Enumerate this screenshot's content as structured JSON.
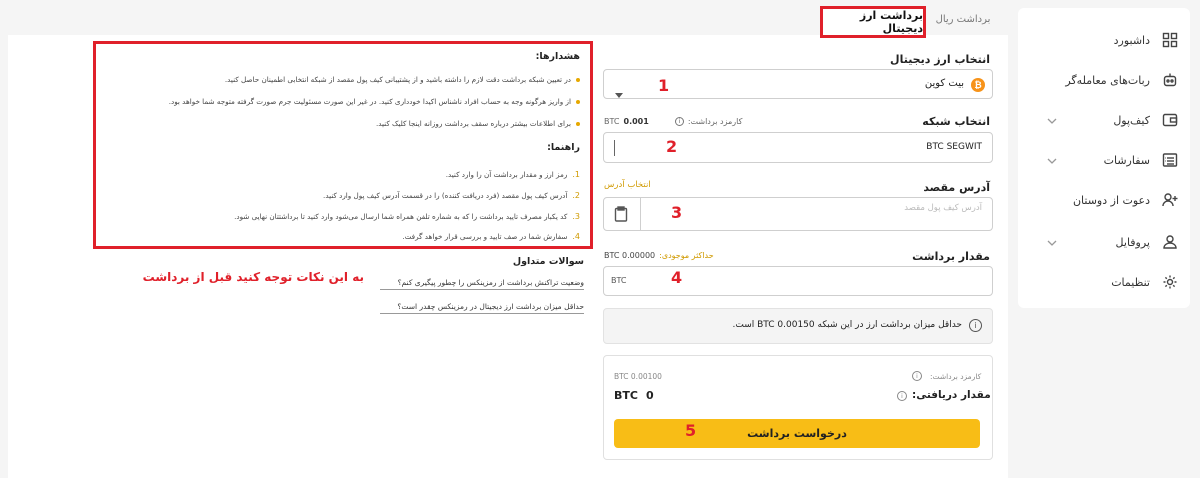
{
  "sidebar": {
    "items": [
      {
        "label": "داشبورد",
        "icon": "grid-icon"
      },
      {
        "label": "ربات‌های معامله‌گر",
        "icon": "robot-icon"
      },
      {
        "label": "کیف‌پول",
        "icon": "wallet-icon"
      },
      {
        "label": "سفارشات",
        "icon": "orders-icon"
      },
      {
        "label": "دعوت از دوستان",
        "icon": "add-user-icon"
      },
      {
        "label": "پروفایل",
        "icon": "user-icon"
      },
      {
        "label": "تنظیمات",
        "icon": "gear-icon"
      }
    ]
  },
  "tabs": {
    "crypto": "برداشت ارز دیجیتال",
    "rial": "برداشت ریال"
  },
  "form": {
    "currency_label": "انتخاب ارز دیجیتال",
    "currency_value": "بیت کوین",
    "network_label": "انتخاب شبکه",
    "fee_label": "کارمزد برداشت:",
    "fee_value": "0.001",
    "fee_unit": "BTC",
    "network_value": "BTC SEGWIT",
    "address_label": "آدرس مقصد",
    "address_select": "انتخاب آدرس",
    "address_placeholder": "آدرس کیف پول مقصد",
    "amount_label": "مقدار برداشت",
    "max_label": "حداکثر موجودی:",
    "max_value": "BTC 0.00000",
    "amount_unit": "BTC",
    "min_notice": "حداقل میزان برداشت ارز در این شبکه BTC 0.00150 است.",
    "summary_fee_label": "کارمزد برداشت:",
    "summary_fee_value": "BTC 0.00100",
    "receive_label": "مقدار دریافتی:",
    "receive_value": "0",
    "receive_unit": "BTC",
    "submit": "درخواست برداشت"
  },
  "markers": [
    "1",
    "2",
    "3",
    "4",
    "5"
  ],
  "warnings": {
    "title": "هشدارها:",
    "items": [
      "در تعیین شبکه برداشت دقت لازم را داشته باشید و از پشتیبانی کیف پول مقصد از شبکه انتخابی اطمینان حاصل کنید.",
      "از واریز هرگونه وجه به حساب افراد ناشناس اکیدا خودداری کنید. در غیر این صورت مسئولیت جرم صورت گرفته متوجه شما خواهد بود.",
      "برای اطلاعات بیشتر درباره سقف برداشت روزانه اینجا کلیک کنید."
    ],
    "guide_title": "راهنما:",
    "guide": [
      "رمز ارز و مقدار برداشت آن را وارد کنید.",
      "آدرس کیف پول مقصد (فرد دریافت کننده) را در قسمت آدرس کیف پول وارد کنید.",
      "کد یکبار مصرف تایید برداشت را که به شماره تلفن همراه شما ارسال می‌شود وارد کنید تا برداشتتان نهایی شود.",
      "سفارش شما در صف تایید و بررسی قرار خواهد گرفت."
    ],
    "guide_numbers": [
      "1.",
      "2.",
      "3.",
      "4."
    ]
  },
  "faq": {
    "title": "سوالات متداول",
    "q1": "وضعیت تراکنش برداشت از رمزینکس را چطور پیگیری کنم؟",
    "q2": "حداقل میزان برداشت ارز دیجیتال در رمزینکس چقدر است؟"
  },
  "annotation": "به این نکات توجه کنید قبل از برداشت",
  "colors": {
    "accent": "#f8bd16",
    "highlight": "#e0202a",
    "bitcoin": "#f7931a"
  }
}
